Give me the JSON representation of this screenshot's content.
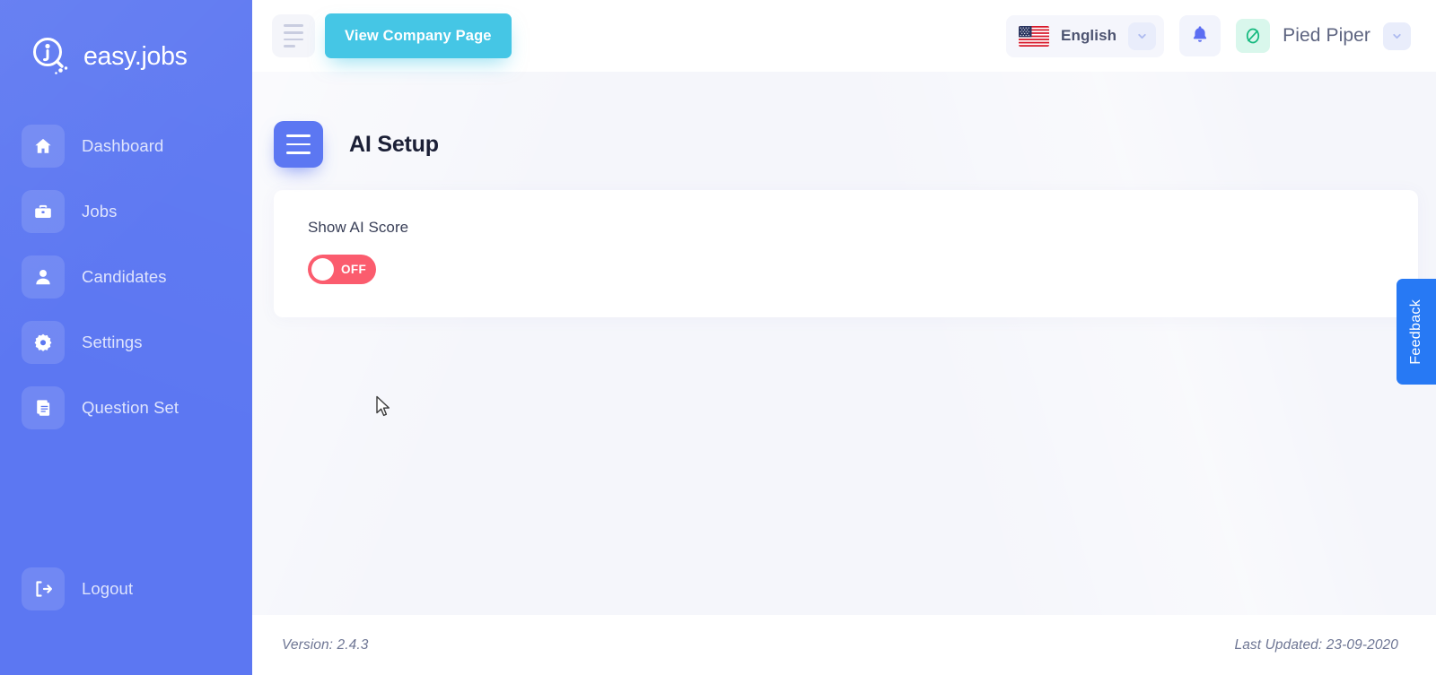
{
  "brand": {
    "name": "easy.jobs",
    "logo_icon": "magnifier-i-logo"
  },
  "sidebar": {
    "items": [
      {
        "label": "Dashboard",
        "icon": "home-icon"
      },
      {
        "label": "Jobs",
        "icon": "briefcase-icon"
      },
      {
        "label": "Candidates",
        "icon": "user-icon"
      },
      {
        "label": "Settings",
        "icon": "gear-icon"
      },
      {
        "label": "Question Set",
        "icon": "document-icon"
      }
    ],
    "logout": {
      "label": "Logout",
      "icon": "logout-icon"
    },
    "background_color": "#5c77f2"
  },
  "topbar": {
    "menu_icon": "hamburger-icon",
    "company_button_label": "View Company Page",
    "company_button_color": "#45c6e5",
    "language": {
      "label": "English",
      "flag_icon": "us-flag-icon",
      "chevron_icon": "chevron-down-icon"
    },
    "notifications_icon": "bell-icon",
    "user": {
      "name": "Pied Piper",
      "logo_icon": "pied-piper-logo",
      "logo_color": "#15b97f",
      "chevron_icon": "chevron-down-icon"
    }
  },
  "page": {
    "menu_icon": "hamburger-icon",
    "title": "AI Setup",
    "card": {
      "label": "Show AI Score",
      "toggle": {
        "state_label": "OFF",
        "is_on": false,
        "off_color": "#fb5c6e"
      }
    }
  },
  "feedback": {
    "label": "Feedback",
    "color": "#2779f4"
  },
  "footer": {
    "version": "Version: 2.4.3",
    "last_updated": "Last Updated: 23-09-2020"
  }
}
